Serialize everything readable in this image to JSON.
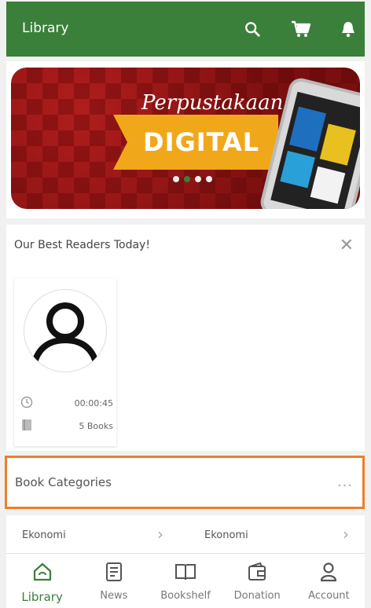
{
  "appbar": {
    "title": "Library",
    "icons": [
      "search-icon",
      "cart-icon",
      "bell-icon"
    ]
  },
  "banner": {
    "script_text": "Perpustakaan",
    "big_text": "DIGITAL",
    "carousel_dots": 4,
    "active_dot": 1
  },
  "best_readers": {
    "title": "Our Best Readers Today!",
    "reader": {
      "time": "00:00:45",
      "books": "5 Books"
    }
  },
  "categories": {
    "title": "Book Categories",
    "more": "...",
    "items": [
      {
        "label": "Ekonomi"
      },
      {
        "label": "Ekonomi"
      }
    ]
  },
  "bottom_nav": {
    "items": [
      {
        "label": "Library",
        "icon": "home-icon",
        "active": true
      },
      {
        "label": "News",
        "icon": "news-icon",
        "active": false
      },
      {
        "label": "Bookshelf",
        "icon": "book-icon",
        "active": false
      },
      {
        "label": "Donation",
        "icon": "wallet-icon",
        "active": false
      },
      {
        "label": "Account",
        "icon": "user-icon",
        "active": false
      }
    ]
  },
  "colors": {
    "primary": "#3a7f3a",
    "highlight": "#ef7d2a",
    "ribbon": "#f0a81a",
    "banner": "#9e1a1a"
  }
}
